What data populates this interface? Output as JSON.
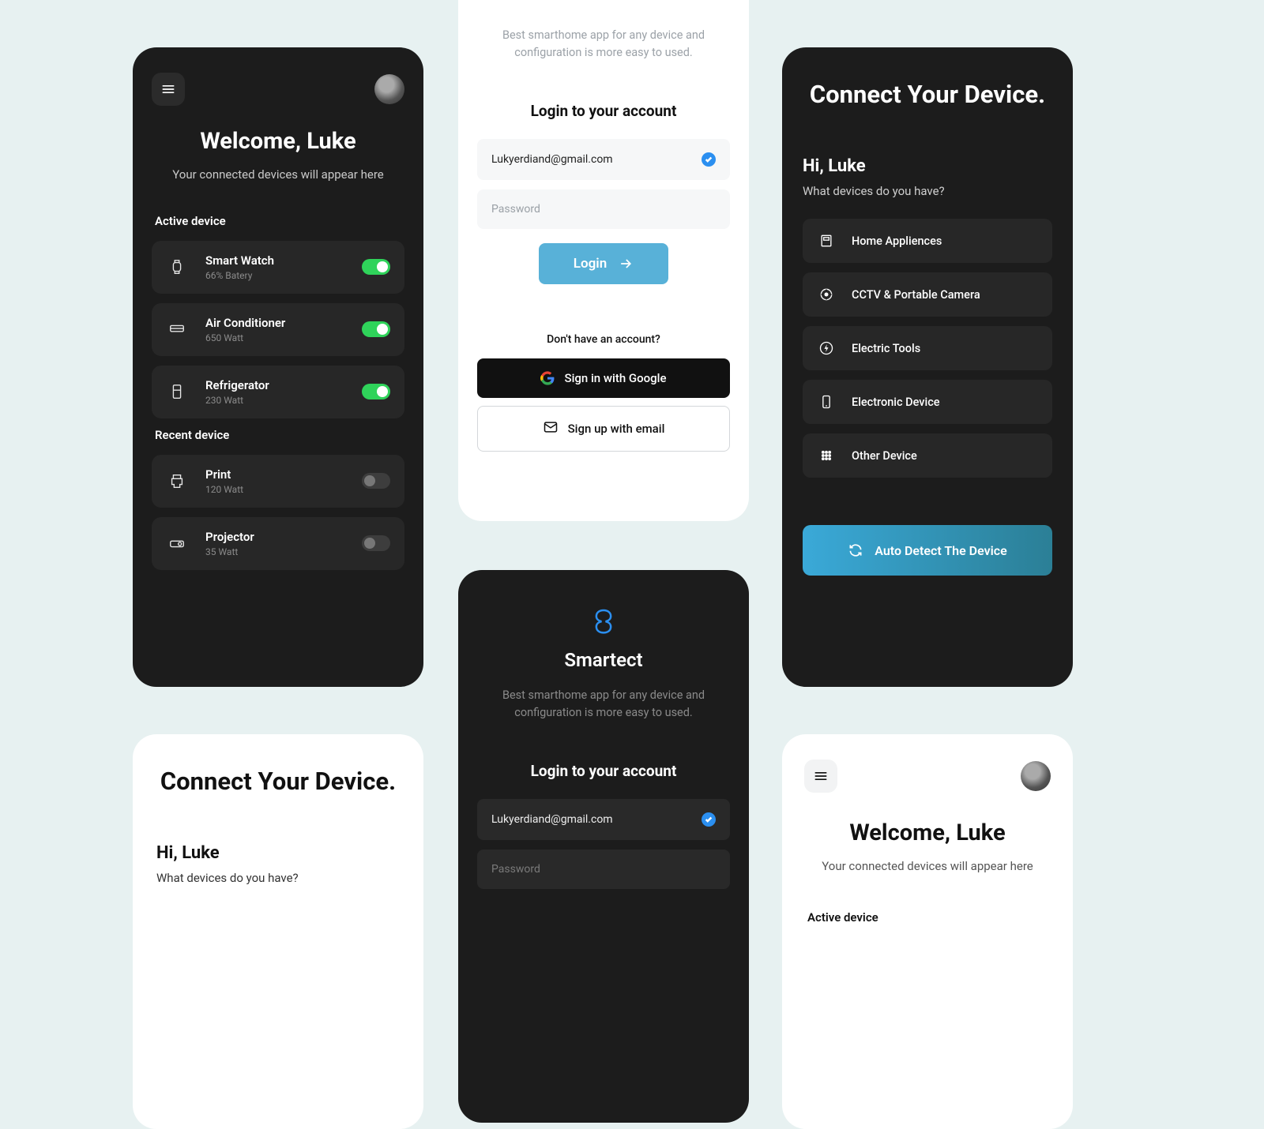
{
  "brand": {
    "name": "Smartect",
    "tagline": "Best smarthome app for any device and configuration is more easy to used."
  },
  "login": {
    "heading": "Login to your account",
    "email_value": "Lukyerdiand@gmail.com",
    "password_placeholder": "Password",
    "login_label": "Login",
    "alt_question": "Don't have an account?",
    "google_label": "Sign in with Google",
    "email_signup_label": "Sign up with email"
  },
  "welcome": {
    "title": "Welcome, Luke",
    "subtitle": "Your connected devices will appear here",
    "active_heading": "Active device",
    "recent_heading": "Recent device",
    "active": [
      {
        "name": "Smart Watch",
        "sub": "66% Batery",
        "on": true
      },
      {
        "name": "Air Conditioner",
        "sub": "650 Watt",
        "on": true
      },
      {
        "name": "Refrigerator",
        "sub": "230 Watt",
        "on": true
      }
    ],
    "recent": [
      {
        "name": "Print",
        "sub": "120 Watt",
        "on": false
      },
      {
        "name": "Projector",
        "sub": "35 Watt",
        "on": false
      }
    ]
  },
  "connect": {
    "title": "Connect Your Device.",
    "hi": "Hi, Luke",
    "question": "What devices do you have?",
    "categories": [
      "Home Appliences",
      "CCTV & Portable Camera",
      "Electric Tools",
      "Electronic Device",
      "Other Device"
    ],
    "auto_label": "Auto Detect The Device"
  }
}
